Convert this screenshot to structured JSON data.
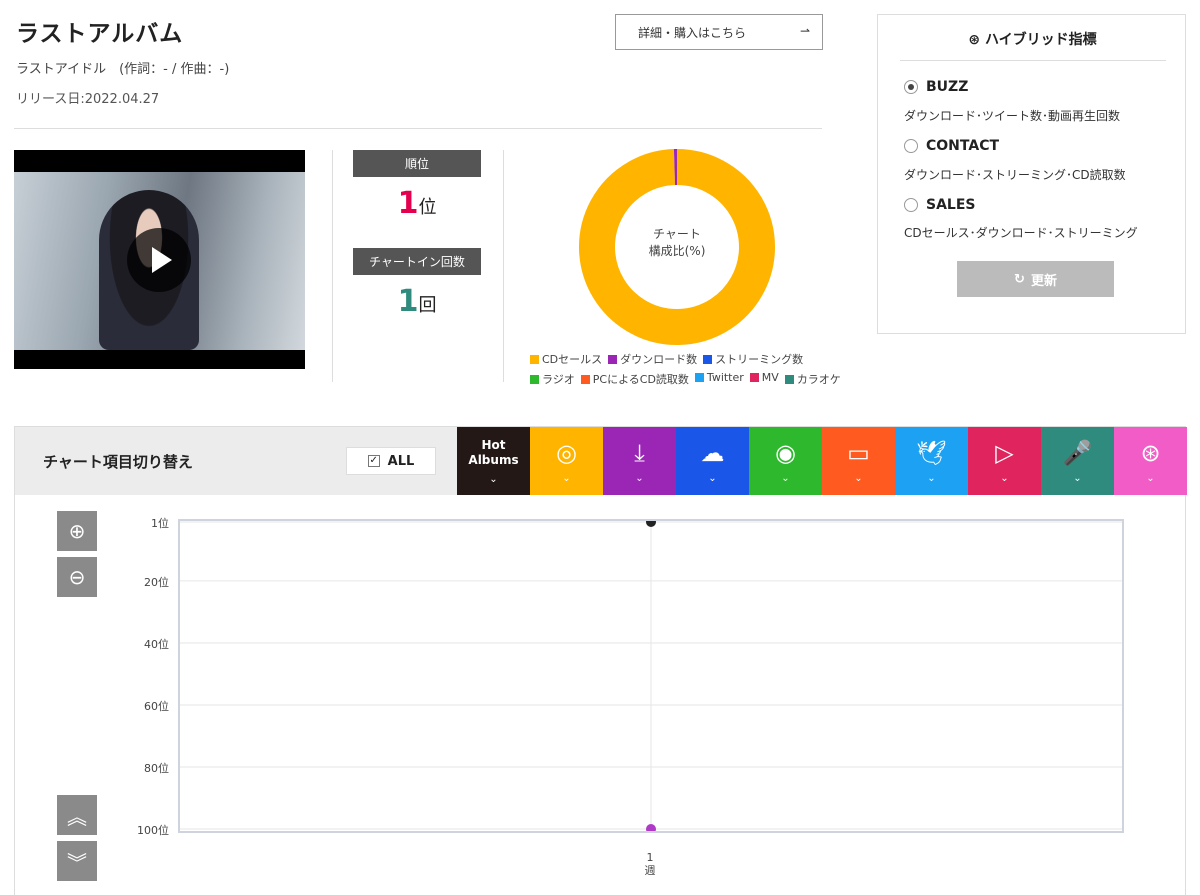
{
  "header": {
    "title": "ラストアルバム",
    "artist_line": "ラストアイドル　(作詞：- / 作曲：-)",
    "release": "リリース日:2022.04.27",
    "detail_button": "詳細・購入はこちら",
    "detail_arrow": "⇀"
  },
  "stats": {
    "rank_label": "順位",
    "rank_value": "1",
    "rank_unit": "位",
    "chartin_label": "チャートイン回数",
    "chartin_value": "1",
    "chartin_unit": "回"
  },
  "breakdown": {
    "center_line1": "チャート",
    "center_line2": "構成比(%)",
    "slices": [
      {
        "name": "CDセールス",
        "value": 99.5,
        "color": "#ffb400"
      },
      {
        "name": "ダウンロード数",
        "value": 0.5,
        "color": "#9b26b6"
      }
    ],
    "legend_row1": [
      {
        "name": "CDセールス",
        "color": "#ffb400"
      },
      {
        "name": "ダウンロード数",
        "color": "#9b26b6"
      },
      {
        "name": "ストリーミング数",
        "color": "#1a56e8"
      }
    ],
    "legend_row2": [
      {
        "name": "ラジオ",
        "color": "#2eb82e"
      },
      {
        "name": "PCによるCD読取数",
        "color": "#ff5a1f"
      },
      {
        "name": "Twitter",
        "color": "#1da1f2"
      },
      {
        "name": "MV",
        "color": "#e0245e"
      },
      {
        "name": "カラオケ",
        "color": "#2e8b7d"
      }
    ]
  },
  "hybrid": {
    "title": "ハイブリッド指標",
    "options": [
      {
        "label": "BUZZ",
        "desc": "ダウンロード･ツイート数･動画再生回数",
        "selected": true
      },
      {
        "label": "CONTACT",
        "desc": "ダウンロード･ストリーミング･CD読取数",
        "selected": false
      },
      {
        "label": "SALES",
        "desc": "CDセールス･ダウンロード･ストリーミング",
        "selected": false
      }
    ],
    "update_button": "更新",
    "update_icon": "↻"
  },
  "chart_switch": {
    "title": "チャート項目切り替え",
    "all_label": "ALL",
    "hot_label_1": "Hot",
    "hot_label_2": "Albums",
    "tabs": [
      {
        "icon": "cd-icon",
        "color": "#ffb400"
      },
      {
        "icon": "download-icon",
        "color": "#9b26b6"
      },
      {
        "icon": "cloud-music-icon",
        "color": "#1a56e8"
      },
      {
        "icon": "radio-icon",
        "color": "#2eb82e"
      },
      {
        "icon": "pc-cd-icon",
        "color": "#ff5a1f"
      },
      {
        "icon": "twitter-icon",
        "color": "#1da1f2"
      },
      {
        "icon": "youtube-icon",
        "color": "#e0245e"
      },
      {
        "icon": "microphone-icon",
        "color": "#2e8b7d"
      },
      {
        "icon": "hybrid-icon",
        "color": "#f25cc6"
      }
    ],
    "hot_color": "#231815"
  },
  "chart_data": {
    "type": "line",
    "y_reversed": true,
    "ylim": [
      1,
      100
    ],
    "y_ticks": [
      "1位",
      "20位",
      "40位",
      "60位",
      "80位",
      "100位"
    ],
    "x_categories": [
      "1\n週"
    ],
    "x_label_top": "1",
    "x_label_bottom": "週",
    "series": [
      {
        "name": "Hot Albums",
        "color": "#222222",
        "values": [
          1
        ]
      },
      {
        "name": "ダウンロード数",
        "color": "#b03ac8",
        "values": [
          100
        ]
      }
    ],
    "grid": true
  }
}
